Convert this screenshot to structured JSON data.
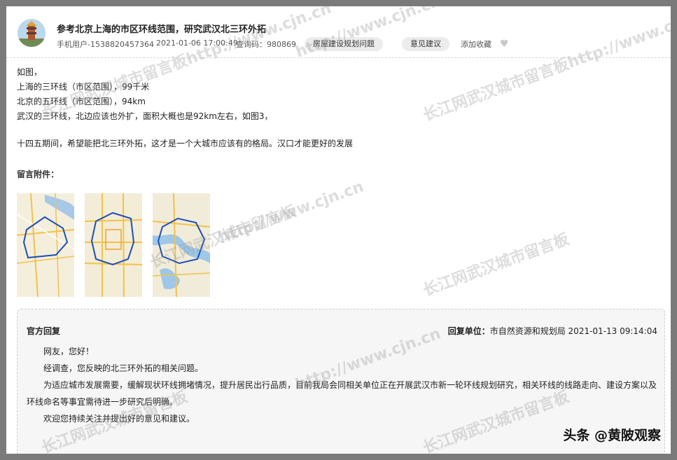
{
  "post": {
    "title": "参考北京上海的市区环线范围，研究武汉北三环外拓",
    "author": "手机用户-1538820457364",
    "datetime": "2021-01-06 17:00:49",
    "query_code": "查询码：980869",
    "category_tag": "房屋建设规划问题",
    "type_tag": "意见建议",
    "favorite_label": "添加收藏",
    "heart_icon": "heart-icon"
  },
  "content": {
    "lines": [
      "如图，",
      "上海的三环线（市区范围），99千米",
      "北京的五环线（市区范围），94km",
      "武汉的三环线，北边应该也外扩，面积大概也是92km左右，如图3，",
      "十四五期间，希望能把北三环外拓，这才是一个大城市应该有的格局。汉口才能更好的发展"
    ]
  },
  "attachments": {
    "label": "留言附件："
  },
  "reply": {
    "label": "官方回复",
    "unit_label": "回复单位：",
    "unit": "市自然资源和规划局 2021-01-13 09:14:04",
    "paragraphs": [
      "网友，您好！",
      "经调查，您反映的北三环外拓的相关问题。",
      "为适应城市发展需要，缓解现状环线拥堵情况，提升居民出行品质，目前我局会同相关单位正在开展武汉市新一轮环线规划研究，相关环线的线路走向、建设方案以及环线命名等事宜需待进一步研究后明确。",
      "欢迎您持续关注并提出好的意见和建议。"
    ]
  },
  "watermarks": {
    "board": "长江网武汉城市留言板",
    "board_url": "长江网武汉城市留言板http://www.cjn.cn",
    "url": "http://www.cjn.cn"
  },
  "brand": "头条 @黄陂观察",
  "colors": {
    "frame": "#7a7a7a",
    "route": "#1f4fb5"
  }
}
